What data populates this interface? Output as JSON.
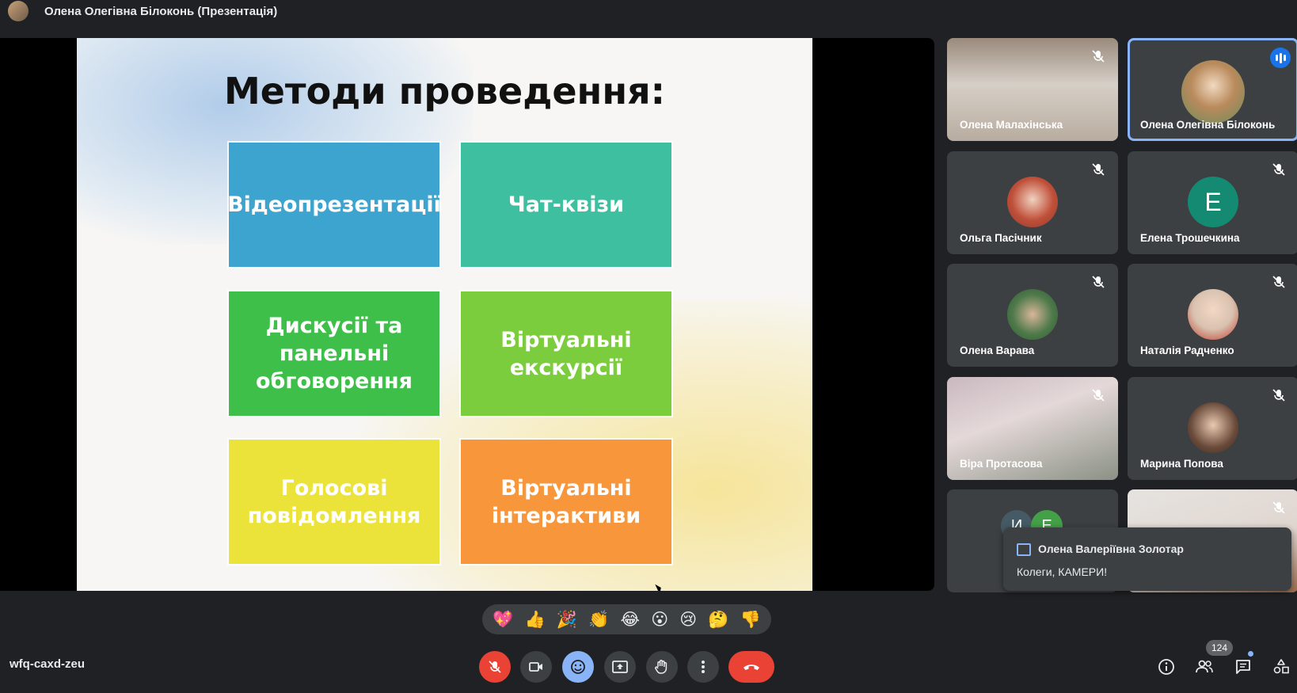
{
  "window": {
    "title": "Олена Олегівна Білоконь (Презентація)"
  },
  "slide": {
    "title": "Методи проведення:",
    "tiles": [
      "Відеопрезентації",
      "Чат-квізи",
      "Дискусії та\nпанельні\nобговорення",
      "Віртуальні\nекскурсії",
      "Голосові\nповідомлення",
      "Віртуальні\nінтерактиви"
    ]
  },
  "participants": [
    {
      "name": "Олена Малахінська",
      "muted": true
    },
    {
      "name": "Олена Олегівна Білоконь",
      "speaking": true
    },
    {
      "name": "Ольга Пасічник",
      "muted": true
    },
    {
      "name": "Елена Трошечкина",
      "initial": "Е",
      "muted": true
    },
    {
      "name": "Олена Варава",
      "muted": true
    },
    {
      "name": "Наталія Радченко",
      "muted": true
    },
    {
      "name": "Віра Протасова",
      "muted": true
    },
    {
      "name": "Марина Попова",
      "muted": true
    }
  ],
  "grouped_tile": {
    "initials": [
      "И",
      "Е"
    ]
  },
  "chat_toast": {
    "sender": "Олена Валеріївна Золотар",
    "message": "Колеги, КАМЕРИ!"
  },
  "reactions": [
    "💖",
    "👍",
    "🎉",
    "👏",
    "😂",
    "😮",
    "😢",
    "🤔",
    "👎"
  ],
  "meeting": {
    "code": "wfq-caxd-zeu",
    "participant_count": "124"
  },
  "icons": {
    "mic_off": "mic-off-icon",
    "camera": "camera-icon",
    "emoji": "emoji-icon",
    "present": "present-icon",
    "raise_hand": "raise-hand-icon",
    "more": "more-options-icon",
    "leave": "leave-call-icon",
    "info": "info-icon",
    "people": "people-icon",
    "chat": "chat-icon",
    "activities": "activities-icon"
  },
  "colors": {
    "accent": "#8ab4f8",
    "danger": "#ea4335",
    "surface": "#3c4043",
    "background": "#202124"
  }
}
